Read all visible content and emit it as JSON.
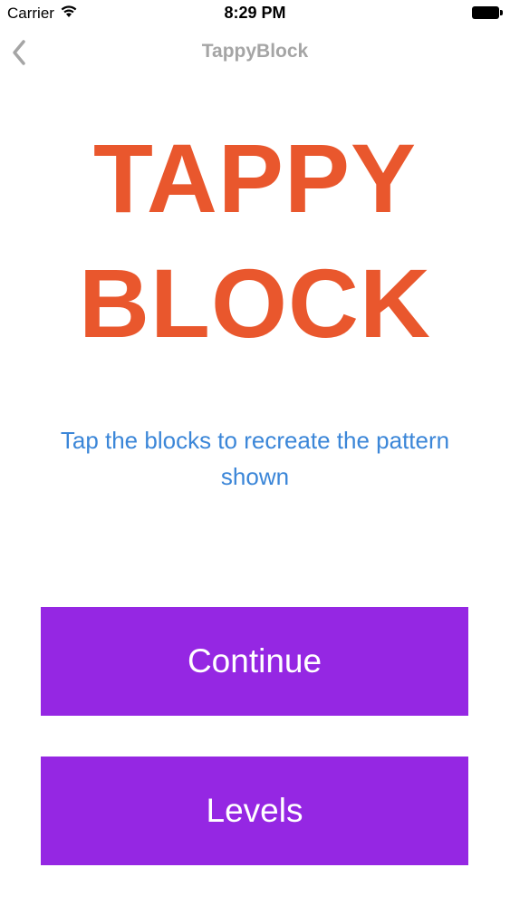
{
  "status_bar": {
    "carrier": "Carrier",
    "time": "8:29 PM",
    "icons": [
      "wifi-icon",
      "battery-icon"
    ]
  },
  "nav": {
    "title": "TappyBlock",
    "back_icon": "chevron-left-icon"
  },
  "logo": {
    "line1": "TAPPY",
    "line2": "BLOCK"
  },
  "instructions": "Tap the blocks to recreate the pattern shown",
  "buttons": {
    "continue": "Continue",
    "levels": "Levels"
  },
  "colors": {
    "logo": "#e9572d",
    "instructions": "#3b86d8",
    "button": "#9527e3",
    "nav_title": "#a5a5a5"
  }
}
